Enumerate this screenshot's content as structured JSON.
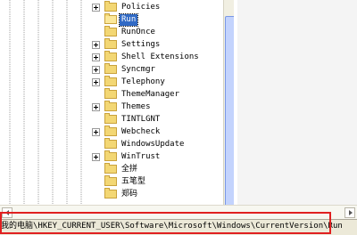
{
  "tree": {
    "items": [
      {
        "label": "Policies",
        "icon": "folder-icon",
        "expandable": true,
        "selected": false
      },
      {
        "label": "Run",
        "icon": "folder-open-icon",
        "expandable": false,
        "selected": true
      },
      {
        "label": "RunOnce",
        "icon": "folder-icon",
        "expandable": false,
        "selected": false
      },
      {
        "label": "Settings",
        "icon": "folder-icon",
        "expandable": true,
        "selected": false
      },
      {
        "label": "Shell Extensions",
        "icon": "folder-icon",
        "expandable": true,
        "selected": false
      },
      {
        "label": "Syncmgr",
        "icon": "folder-icon",
        "expandable": true,
        "selected": false
      },
      {
        "label": "Telephony",
        "icon": "folder-icon",
        "expandable": true,
        "selected": false
      },
      {
        "label": "ThemeManager",
        "icon": "folder-icon",
        "expandable": false,
        "selected": false
      },
      {
        "label": "Themes",
        "icon": "folder-icon",
        "expandable": true,
        "selected": false
      },
      {
        "label": "TINTLGNT",
        "icon": "folder-icon",
        "expandable": false,
        "selected": false
      },
      {
        "label": "Webcheck",
        "icon": "folder-icon",
        "expandable": true,
        "selected": false
      },
      {
        "label": "WindowsUpdate",
        "icon": "folder-icon",
        "expandable": false,
        "selected": false
      },
      {
        "label": "WinTrust",
        "icon": "folder-icon",
        "expandable": true,
        "selected": false
      },
      {
        "label": "全拼",
        "icon": "folder-icon",
        "expandable": false,
        "selected": false
      },
      {
        "label": "五笔型",
        "icon": "folder-icon",
        "expandable": false,
        "selected": false
      },
      {
        "label": "郑码",
        "icon": "folder-icon",
        "expandable": false,
        "selected": false
      }
    ]
  },
  "status_bar": {
    "path": "我的电脑\\HKEY_CURRENT_USER\\Software\\Microsoft\\Windows\\CurrentVersion\\Run"
  },
  "colors": {
    "selection": "#316ac5",
    "highlight_border": "#e02020",
    "folder": "#f3d774"
  }
}
